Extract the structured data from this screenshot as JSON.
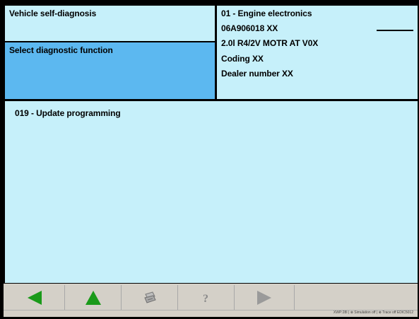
{
  "left_panel": {
    "title": "Vehicle self-diagnosis",
    "selected_function_label": "Select diagnostic function"
  },
  "ecu_info": {
    "address_name": "01 - Engine electronics",
    "part_number": "06A906018 XX",
    "engine_desc": "2.0l R4/2V  MOTR AT V0X",
    "coding": "Coding XX",
    "dealer": "Dealer number XX"
  },
  "main": {
    "function_title": "019 - Update programming"
  },
  "toolbar": {
    "buttons": [
      {
        "icon": "arrow-left-icon",
        "color": "#1a9a1a"
      },
      {
        "icon": "arrow-up-icon",
        "color": "#1a9a1a"
      },
      {
        "icon": "print-icon",
        "color": "#8a8a8a"
      },
      {
        "icon": "help-icon",
        "color": "#8a8a8a"
      },
      {
        "icon": "arrow-right-icon",
        "color": "#8a8a8a"
      }
    ]
  },
  "status": {
    "text": "XWP:28I  | ⊗ Simulation off  | ⊗ Trace off  EDIC5012"
  },
  "colors": {
    "panel_bg": "#c6f0fa",
    "selected_bg": "#5cb8f0",
    "border": "#000000",
    "toolbar_bg": "#d4d0c8"
  }
}
